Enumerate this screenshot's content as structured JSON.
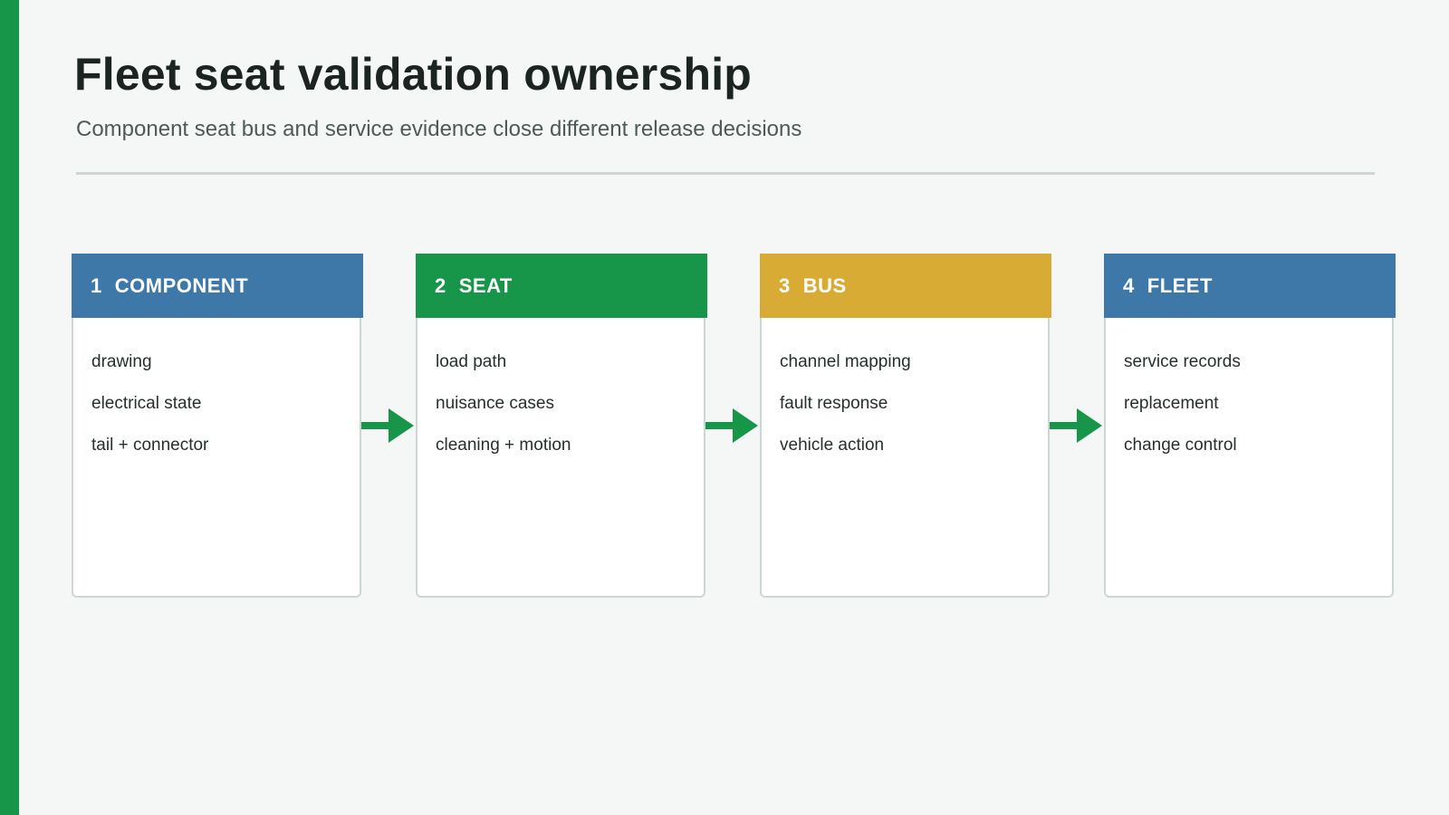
{
  "title": "Fleet seat validation ownership",
  "subtitle": "Component seat bus and service evidence close different release decisions",
  "colors": {
    "accent": "#17964a",
    "blue": "#3d78a9",
    "green": "#17964a",
    "gold": "#d8ab35",
    "rule": "#ccd6d3"
  },
  "stages": [
    {
      "num": "1",
      "label": "COMPONENT",
      "color": "#3d78a9",
      "items": [
        "drawing",
        "electrical state",
        "tail + connector"
      ]
    },
    {
      "num": "2",
      "label": "SEAT",
      "color": "#17964a",
      "items": [
        "load path",
        "nuisance cases",
        "cleaning + motion"
      ]
    },
    {
      "num": "3",
      "label": "BUS",
      "color": "#d8ab35",
      "items": [
        "channel mapping",
        "fault response",
        "vehicle action"
      ]
    },
    {
      "num": "4",
      "label": "FLEET",
      "color": "#3d78a9",
      "items": [
        "service records",
        "replacement",
        "change control"
      ]
    }
  ],
  "connector_icon": "arrow-right-icon"
}
